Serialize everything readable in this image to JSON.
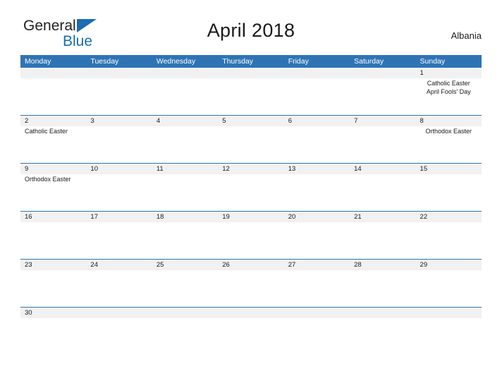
{
  "brand": {
    "name_part1": "General",
    "name_part2": "Blue",
    "triangle_icon": "triangle-icon",
    "accent_color": "#1b6cb0"
  },
  "header": {
    "title": "April 2018",
    "country": "Albania"
  },
  "calendar": {
    "header_color": "#2e74b5",
    "day_band_color": "#f1f1f1",
    "separator_color": "#2e74b5",
    "weekdays": [
      "Monday",
      "Tuesday",
      "Wednesday",
      "Thursday",
      "Friday",
      "Saturday",
      "Sunday"
    ],
    "weeks": [
      {
        "days": [
          {
            "num": "",
            "events": []
          },
          {
            "num": "",
            "events": []
          },
          {
            "num": "",
            "events": []
          },
          {
            "num": "",
            "events": []
          },
          {
            "num": "",
            "events": []
          },
          {
            "num": "",
            "events": []
          },
          {
            "num": "1",
            "events": [
              "Catholic Easter",
              "April Fools' Day"
            ]
          }
        ]
      },
      {
        "days": [
          {
            "num": "2",
            "events": [
              "Catholic Easter"
            ],
            "align": "left"
          },
          {
            "num": "3",
            "events": []
          },
          {
            "num": "4",
            "events": []
          },
          {
            "num": "5",
            "events": []
          },
          {
            "num": "6",
            "events": []
          },
          {
            "num": "7",
            "events": []
          },
          {
            "num": "8",
            "events": [
              "Orthodox Easter"
            ]
          }
        ]
      },
      {
        "days": [
          {
            "num": "9",
            "events": [
              "Orthodox Easter"
            ],
            "align": "left"
          },
          {
            "num": "10",
            "events": []
          },
          {
            "num": "11",
            "events": []
          },
          {
            "num": "12",
            "events": []
          },
          {
            "num": "13",
            "events": []
          },
          {
            "num": "14",
            "events": []
          },
          {
            "num": "15",
            "events": []
          }
        ]
      },
      {
        "days": [
          {
            "num": "16",
            "events": []
          },
          {
            "num": "17",
            "events": []
          },
          {
            "num": "18",
            "events": []
          },
          {
            "num": "19",
            "events": []
          },
          {
            "num": "20",
            "events": []
          },
          {
            "num": "21",
            "events": []
          },
          {
            "num": "22",
            "events": []
          }
        ]
      },
      {
        "days": [
          {
            "num": "23",
            "events": []
          },
          {
            "num": "24",
            "events": []
          },
          {
            "num": "25",
            "events": []
          },
          {
            "num": "26",
            "events": []
          },
          {
            "num": "27",
            "events": []
          },
          {
            "num": "28",
            "events": []
          },
          {
            "num": "29",
            "events": []
          }
        ]
      },
      {
        "last": true,
        "days": [
          {
            "num": "30",
            "events": []
          },
          {
            "num": "",
            "events": []
          },
          {
            "num": "",
            "events": []
          },
          {
            "num": "",
            "events": []
          },
          {
            "num": "",
            "events": []
          },
          {
            "num": "",
            "events": []
          },
          {
            "num": "",
            "events": []
          }
        ]
      }
    ]
  }
}
